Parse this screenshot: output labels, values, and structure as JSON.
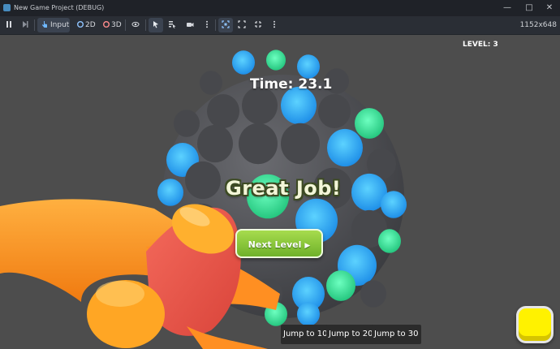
{
  "window": {
    "title": "New Game Project (DEBUG)",
    "controls": [
      "minimize",
      "maximize",
      "close"
    ]
  },
  "toolbar": {
    "pause_icon": "pause-icon",
    "next_frame_icon": "next-frame-icon",
    "input_label": "Input",
    "mode_2d_label": "2D",
    "mode_3d_label": "3D",
    "resolution": "1152x648",
    "accent": "#478cbf"
  },
  "game": {
    "level_label": "LEVEL: 3",
    "timer": "Time: 23.1",
    "great_job": "Great Job!",
    "next_level_label": "Next Level",
    "jump_buttons": [
      "Jump to 10",
      "Jump to 20",
      "Jump to 30"
    ],
    "colors": {
      "ball_dark": "#55565a",
      "hole_blue": "#2aa8f0",
      "hole_green": "#33e08f",
      "hammer_orange": "#ff9a1f",
      "hammer_red": "#ee5a4f",
      "button_green": "#8ccc3c",
      "yellow_button": "#fff200"
    }
  }
}
